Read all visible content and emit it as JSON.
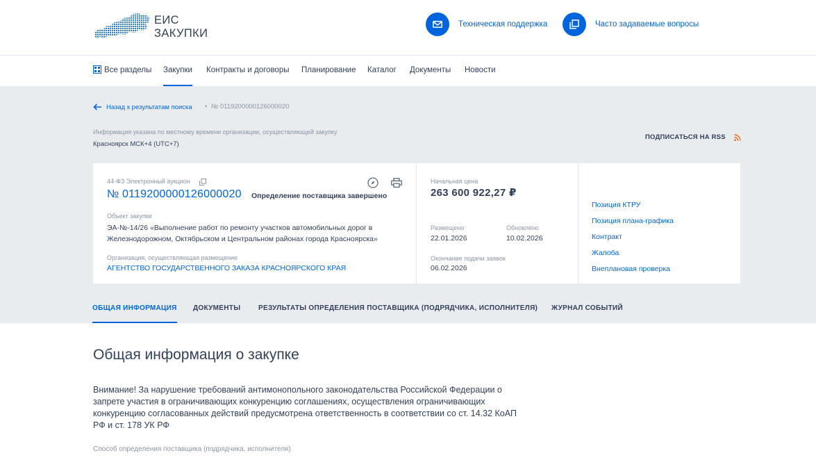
{
  "header": {
    "logo": {
      "line1": "ЕИС",
      "line2": "ЗАКУПКИ"
    },
    "support_label": "Техническая поддержка",
    "faq_label": "Часто задаваемые вопросы"
  },
  "nav": {
    "items": [
      {
        "label": "Все разделы"
      },
      {
        "label": "Закупки"
      },
      {
        "label": "Контракты и договоры"
      },
      {
        "label": "Планирование"
      },
      {
        "label": "Каталог"
      },
      {
        "label": "Документы"
      },
      {
        "label": "Новости"
      }
    ],
    "active_index": 1
  },
  "breadcrumb": {
    "back_label": "Назад к результатам поиска",
    "separator": "•",
    "current": "№ 0119200000126000020"
  },
  "timezone": {
    "note": "Информация указана по местному времени организации, осуществляющей закупку",
    "value": "Красноярск МСК+4 (UTC+7)"
  },
  "rss_label": "ПОДПИСАТЬСЯ НА RSS",
  "card": {
    "law": "44-ФЗ Электронный аукцион",
    "number": "№ 0119200000126000020",
    "status": "Определение поставщика завершено",
    "object_label": "Объект закупки",
    "object_value": "ЭА-№-14/26 «Выполнение работ по ремонту участков автомобильных дорог в Железнодорожном, Октябрьском и Центральном районах города Красноярска»",
    "org_label": "Организация, осуществляющая размещение",
    "org_value": "АГЕНТСТВО ГОСУДАРСТВЕННОГО ЗАКАЗА КРАСНОЯРСКОГО КРАЯ",
    "price_label": "Начальная цена",
    "price_value": "263 600 922,27 ₽",
    "published_label": "Размещено",
    "published_value": "22.01.2026",
    "updated_label": "Обновлено",
    "updated_value": "10.02.2026",
    "deadline_label": "Окончание подачи заявок",
    "deadline_value": "06.02.2026",
    "links": [
      {
        "label": "Позиция КТРУ"
      },
      {
        "label": "Позиция плана-графика"
      },
      {
        "label": "Контракт"
      },
      {
        "label": "Жалоба"
      },
      {
        "label": "Внеплановая проверка"
      }
    ]
  },
  "tabs": [
    {
      "label": "ОБЩАЯ ИНФОРМАЦИЯ"
    },
    {
      "label": "ДОКУМЕНТЫ"
    },
    {
      "label": "РЕЗУЛЬТАТЫ ОПРЕДЕЛЕНИЯ ПОСТАВЩИКА (ПОДРЯДЧИКА, ИСПОЛНИТЕЛЯ)"
    },
    {
      "label": "ЖУРНАЛ СОБЫТИЙ"
    }
  ],
  "main": {
    "title": "Общая информация о закупке",
    "warning": "Внимание! За нарушение требований антимонопольного законодательства Российской Федерации о запрете участия в ограничивающих конкуренцию соглашениях, осуществления ограничивающих конкуренцию согласованных действий предусмотрена ответственность в соответствии со ст. 14.32 КоАП РФ и ст. 178 УК РФ",
    "method_label": "Способ определения поставщика (подрядчика, исполнителя)"
  },
  "colors": {
    "accent": "#0065dd",
    "text": "#334059",
    "muted": "#8a95a5",
    "band": "#e9ecef",
    "rss": "#f26d21"
  }
}
